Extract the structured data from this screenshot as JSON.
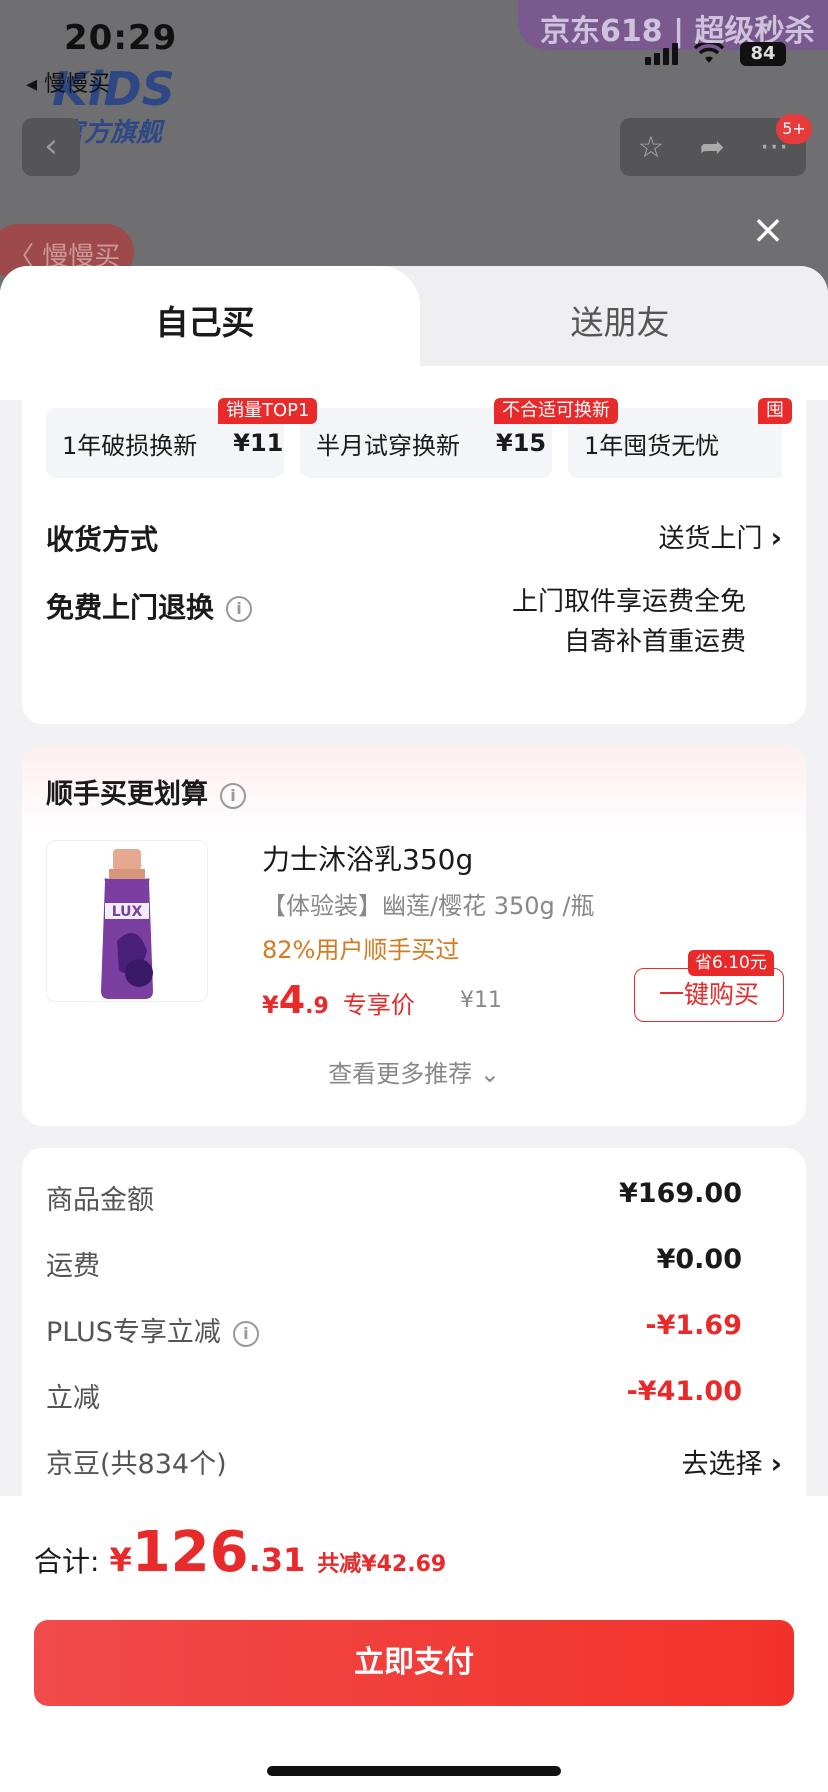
{
  "status": {
    "time": "20:29",
    "back_app": "◂ 慢慢买",
    "battery": "84"
  },
  "backdrop": {
    "brand": "KiDS",
    "brand_sub": "官方旗舰",
    "banner": "京东618 | 超级秒杀",
    "cart_badge": "5+",
    "pill": "〈 慢慢买"
  },
  "tabs": {
    "self": "自己买",
    "friend": "送朋友"
  },
  "services": [
    {
      "label": "1年破损换新",
      "price": "¥11",
      "tag": "销量TOP1"
    },
    {
      "label": "半月试穿换新",
      "price": "¥15",
      "tag": "不合适可换新"
    },
    {
      "label": "1年囤货无忧",
      "price": "",
      "tag": "囤"
    }
  ],
  "delivery": {
    "label": "收货方式",
    "value": "送货上门"
  },
  "free_return": {
    "label": "免费上门退换",
    "line1": "上门取件享运费全免",
    "line2": "自寄补首重运费"
  },
  "recommend": {
    "title": "顺手买更划算",
    "product": {
      "name": "力士沐浴乳350g",
      "spec": "【体验装】幽莲/樱花  350g /瓶",
      "pct": "82%用户顺手买过",
      "price_yen": "¥",
      "price_int": "4",
      "price_dec": ".9",
      "price_label": "专享价",
      "orig": "¥11",
      "buy": "一键购买",
      "save_tag": "省6.10元",
      "brand": "LUX"
    },
    "more": "查看更多推荐"
  },
  "summary": [
    {
      "label": "商品金额",
      "value": "¥169.00",
      "red": false
    },
    {
      "label": "运费",
      "value": "¥0.00",
      "red": false
    },
    {
      "label": "PLUS专享立减",
      "value": "-¥1.69",
      "red": true
    },
    {
      "label": "立减",
      "value": "-¥41.00",
      "red": true
    },
    {
      "label": "京豆(共834个)",
      "value": "去选择",
      "red": false
    }
  ],
  "footer": {
    "total_label": "合计:",
    "yen": "¥",
    "total_int": "126",
    "total_dec": ".31",
    "saved": "共减¥42.69",
    "pay": "立即支付"
  },
  "colors": {
    "accent": "#e82a2a",
    "orange": "#d57a20"
  }
}
